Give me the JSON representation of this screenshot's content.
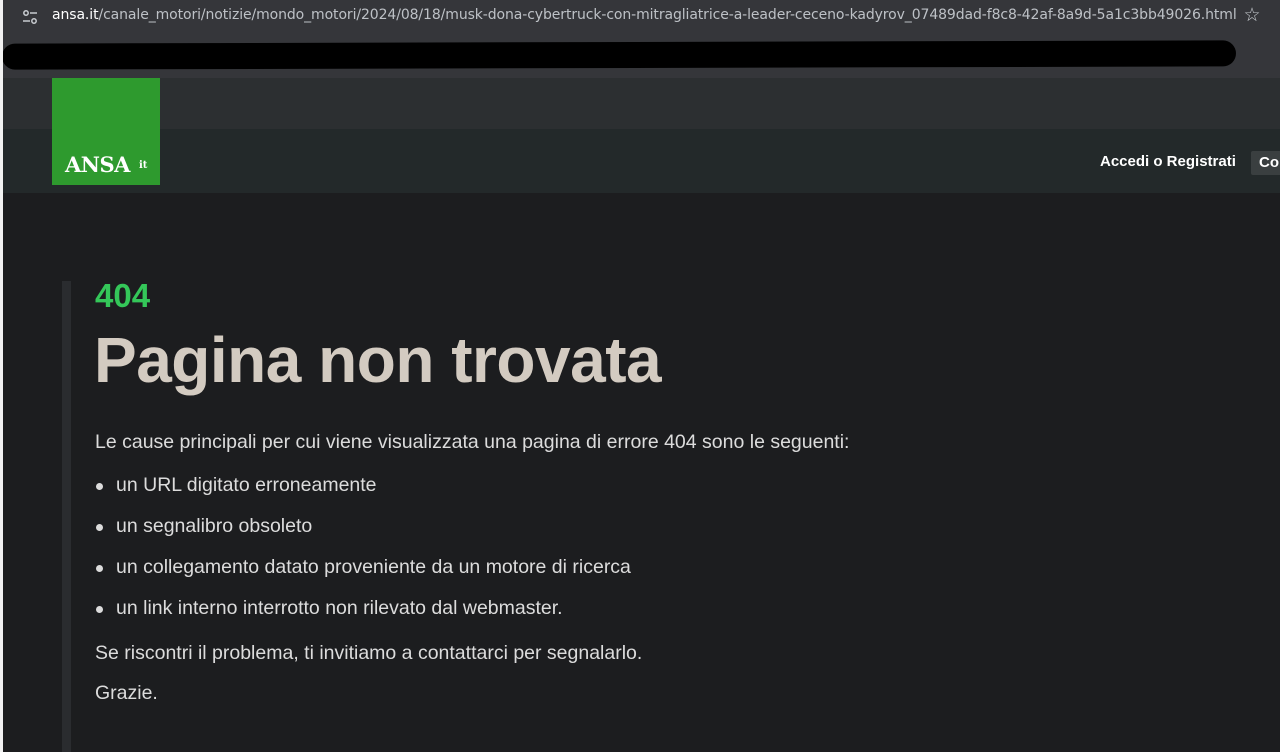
{
  "browser": {
    "url_host": "ansa.it",
    "url_path": "/canale_motori/notizie/mondo_motori/2024/08/18/musk-dona-cybertruck-con-mitragliatrice-a-leader-ceceno-kadyrov_07489dad-f8c8-42af-8a9d-5a1c3bb49026.html",
    "site_info_icon": "tune-icon",
    "bookmark_icon": "star-icon"
  },
  "header": {
    "logo_text": "ANSA",
    "logo_suffix": "it",
    "logo_color": "#2e9a2e",
    "login_label": "Accedi o Registrati",
    "nav_button_label": "Co"
  },
  "error": {
    "code": "404",
    "code_color": "#34c759",
    "title": "Pagina non trovata",
    "intro": "Le cause principali per cui viene visualizzata una pagina di errore 404 sono le seguenti:",
    "causes": [
      "un URL digitato erroneamente",
      "un segnalibro obsoleto",
      "un collegamento datato proveniente da un motore di ricerca",
      "un link interno interrotto non rilevato dal webmaster."
    ],
    "contact": "Se riscontri il problema, ti invitiamo a contattarci per segnalarlo.",
    "thanks": "Grazie."
  }
}
